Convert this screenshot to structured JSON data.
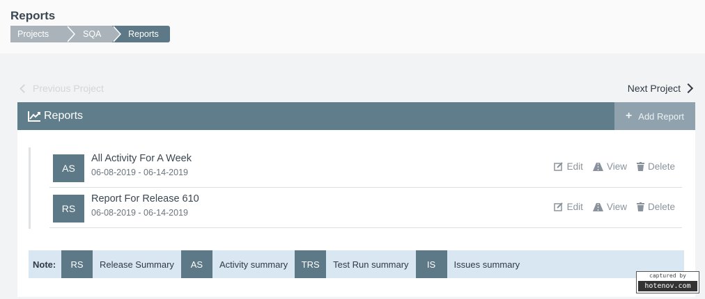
{
  "page": {
    "title": "Reports"
  },
  "breadcrumb": [
    "Projects",
    "SQA",
    "Reports"
  ],
  "nav": {
    "prev": "Previous Project",
    "next": "Next Project"
  },
  "panel": {
    "title": "Reports",
    "add_label": "Add Report"
  },
  "reports": [
    {
      "abbr": "AS",
      "title": "All Activity For A Week",
      "dates": "06-08-2019 - 06-14-2019"
    },
    {
      "abbr": "RS",
      "title": "Report For Release 610",
      "dates": "06-08-2019 - 06-14-2019"
    }
  ],
  "actions": {
    "edit": "Edit",
    "view": "View",
    "delete": "Delete"
  },
  "note": {
    "label": "Note:",
    "items": [
      {
        "abbr": "RS",
        "text": "Release Summary"
      },
      {
        "abbr": "AS",
        "text": "Activity summary"
      },
      {
        "abbr": "TRS",
        "text": "Test Run summary"
      },
      {
        "abbr": "IS",
        "text": "Issues summary"
      }
    ]
  },
  "watermark": {
    "top": "captured by",
    "bottom": "hotenov.com"
  },
  "colors": {
    "header": "#607d8b",
    "accent": "#5d7886",
    "note_bg": "#d9e7f2"
  },
  "icons": {
    "header": "chart-line-icon",
    "add": "plus-icon",
    "edit": "edit-icon",
    "view": "road-icon",
    "delete": "trash-icon",
    "prev": "chevron-left-icon",
    "next": "chevron-right-icon"
  }
}
